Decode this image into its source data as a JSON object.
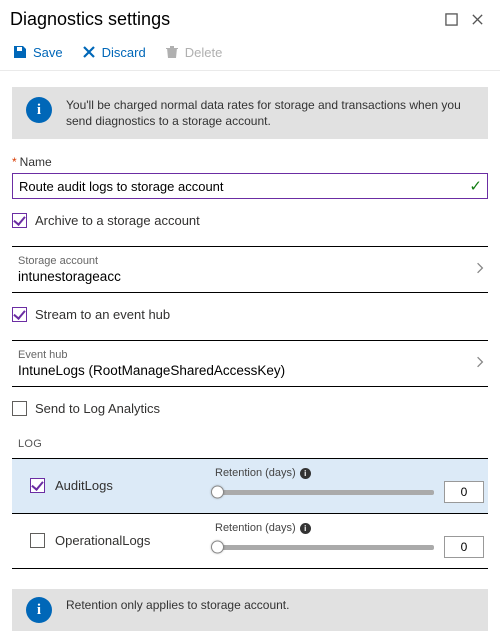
{
  "header": {
    "title": "Diagnostics settings"
  },
  "toolbar": {
    "save_label": "Save",
    "discard_label": "Discard",
    "delete_label": "Delete"
  },
  "notice": {
    "top": "You'll be charged normal data rates for storage and transactions when you send diagnostics to a storage account.",
    "bottom": "Retention only applies to storage account."
  },
  "form": {
    "name_label": "Name",
    "name_value": "Route audit logs to storage account",
    "archive_label": "Archive to a storage account",
    "archive_checked": true,
    "stream_label": "Stream to an event hub",
    "stream_checked": true,
    "log_analytics_label": "Send to Log Analytics",
    "log_analytics_checked": false
  },
  "pickers": {
    "storage": {
      "label": "Storage account",
      "value": "intunestorageacc"
    },
    "eventhub": {
      "label": "Event hub",
      "value": "IntuneLogs (RootManageSharedAccessKey)"
    }
  },
  "log_section": {
    "heading": "LOG",
    "retention_label": "Retention (days)",
    "rows": [
      {
        "name": "AuditLogs",
        "checked": true,
        "retention": 0,
        "selected": true
      },
      {
        "name": "OperationalLogs",
        "checked": false,
        "retention": 0,
        "selected": false
      }
    ]
  }
}
